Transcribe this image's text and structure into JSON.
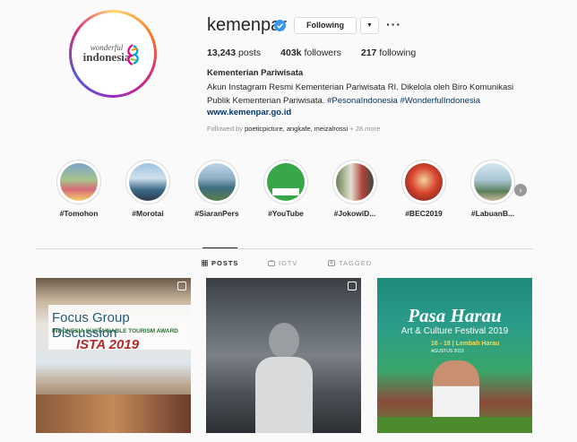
{
  "profile": {
    "logo_top": "wonderful",
    "logo_main": "indonesia",
    "username": "kemenpar",
    "follow_label": "Following",
    "posts_count": "13,243",
    "posts_label": "posts",
    "followers_count": "403k",
    "followers_label": "followers",
    "following_count": "217",
    "following_label": "following",
    "full_name": "Kementerian Pariwisata",
    "bio_line1": "Akun Instagram Resmi Kementerian Pariwisata RI. Dikelola oleh Biro Komunikasi",
    "bio_line2": "Publik Kementerian Pariwisata.",
    "bio_tags": "#PesonaIndonesia #WonderfulIndonesia",
    "website": "www.kemenpar.go.id",
    "followed_by_prefix": "Followed by",
    "followed_by_names": "poeticpicture, angkafe, meizalrossi",
    "followed_by_more": "+ 28 more"
  },
  "highlights": [
    {
      "label": "#Tomohon"
    },
    {
      "label": "#Morotai"
    },
    {
      "label": "#SiaranPers"
    },
    {
      "label": "#YouTube"
    },
    {
      "label": "#JokowiD..."
    },
    {
      "label": "#BEC2019"
    },
    {
      "label": "#LabuanB..."
    }
  ],
  "tabs": {
    "posts": "POSTS",
    "igtv": "IGTV",
    "tagged": "TAGGED"
  },
  "posts": [
    {
      "title": "Focus Group Discussion",
      "subtitle": "INDONESIA SUSTAINABLE TOURISM AWARD",
      "tag": "ISTA 2019"
    },
    {
      "title": "",
      "subtitle": "",
      "tag": ""
    },
    {
      "title": "Pasa Harau",
      "subtitle": "Art & Culture Festival 2019",
      "date": "16 - 18 | Lembah Harau",
      "month": "AGUSTUS 2019"
    }
  ],
  "colors": {
    "link": "#003569",
    "verified": "#3897f0",
    "border": "#dbdbdb"
  }
}
